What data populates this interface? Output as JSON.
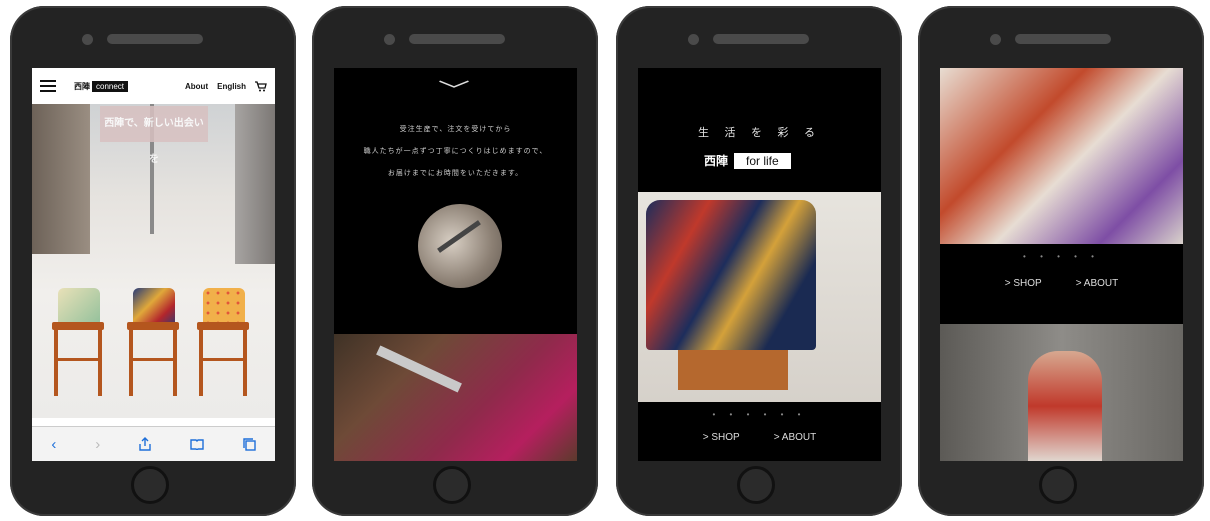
{
  "phone1": {
    "brand": "西陣",
    "brand_tag": "connect",
    "nav_about": "About",
    "nav_lang": "English",
    "cart_icon": "cart-icon",
    "sign_text": "西陣で、新しい出会いを",
    "safari": [
      "‹",
      "›",
      "share",
      "book",
      "tabs"
    ]
  },
  "phone2": {
    "lines": [
      "受注生産で、注文を受けてから",
      "職人たちが一点ずつ丁寧につくりはじめますので、",
      "お届けまでにお時間をいただきます。"
    ]
  },
  "phone3": {
    "tagline": "生 活 を 彩 る",
    "logo": "西陣",
    "logo_tag": "for life",
    "dots": "• • • • • •",
    "shop": "> SHOP",
    "about": "> ABOUT"
  },
  "phone4": {
    "dots": "• • • • •",
    "shop": "> SHOP",
    "about": "> ABOUT"
  }
}
